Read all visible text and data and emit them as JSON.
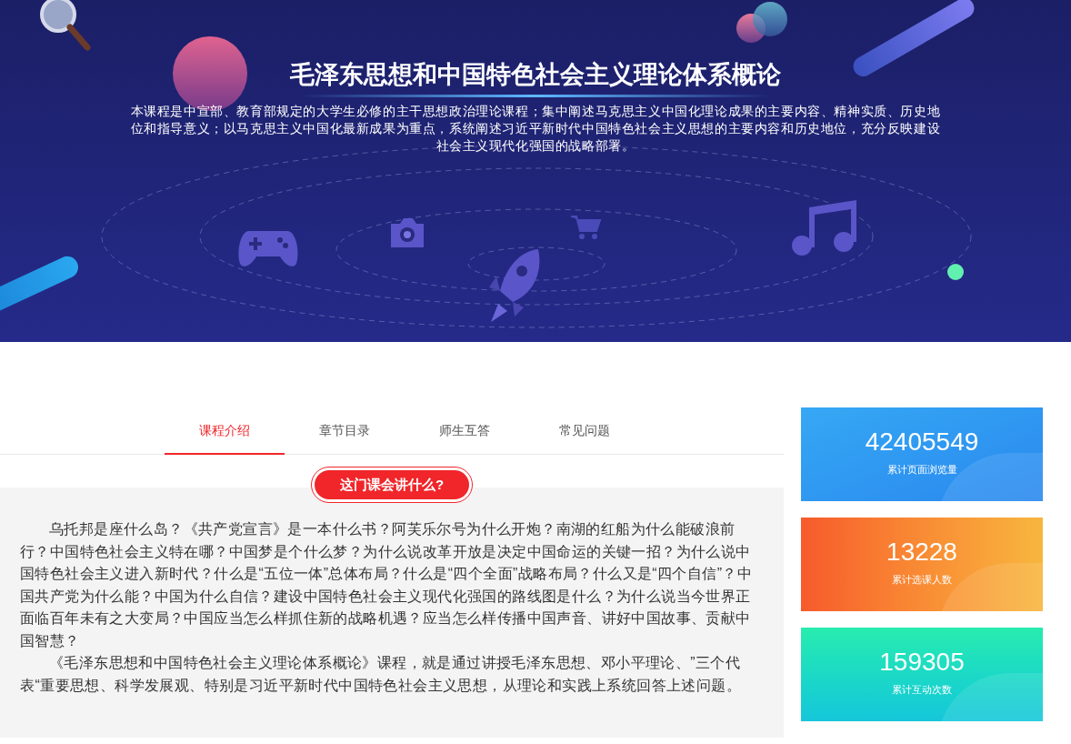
{
  "banner": {
    "title": "毛泽东思想和中国特色社会主义理论体系概论",
    "description": "本课程是中宣部、教育部规定的大学生必修的主干思想政治理论课程；集中阐述马克思主义中国化理论成果的主要内容、精神实质、历史地位和指导意义；以马克思主义中国化最新成果为重点，系统阐述习近平新时代中国特色社会主义思想的主要内容和历史地位，充分反映建设社会主义现代化强国的战略部署。"
  },
  "tabs": [
    {
      "label": "课程介绍",
      "selected": true
    },
    {
      "label": "章节目录",
      "selected": false
    },
    {
      "label": "师生互答",
      "selected": false
    },
    {
      "label": "常见问题",
      "selected": false
    }
  ],
  "intro": {
    "heading": "这门课会讲什么?",
    "paragraphs": [
      "乌托邦是座什么岛？《共产党宣言》是一本什么书？阿芙乐尔号为什么开炮？南湖的红船为什么能破浪前行？中国特色社会主义特在哪？中国梦是个什么梦？为什么说改革开放是决定中国命运的关键一招？为什么说中国特色社会主义进入新时代？什么是“五位一体”总体布局？什么是“四个全面”战略布局？什么又是“四个自信”？中国共产党为什么能？中国为什么自信？建设中国特色社会主义现代化强国的路线图是什么？为什么说当今世界正面临百年未有之大变局？中国应当怎么样抓住新的战略机遇？应当怎么样传播中国声音、讲好中国故事、贡献中国智慧？",
      "《毛泽东思想和中国特色社会主义理论体系概论》课程，就是通过讲授毛泽东思想、邓小平理论、”三个代表“重要思想、科学发展观、特别是习近平新时代中国特色社会主义思想，从理论和实践上系统回答上述问题。"
    ]
  },
  "stats": [
    {
      "kind": "blue",
      "value": "42405549",
      "label": "累计页面浏览量"
    },
    {
      "kind": "orange",
      "value": "13228",
      "label": "累计选课人数"
    },
    {
      "kind": "teal",
      "value": "159305",
      "label": "累计互动次数"
    }
  ]
}
